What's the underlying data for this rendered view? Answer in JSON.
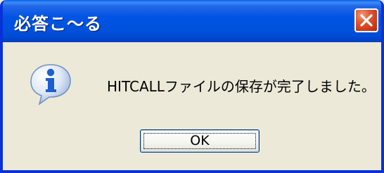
{
  "dialog": {
    "title": "必答こ〜る",
    "message": "HITCALLファイルの保存が完了しました。",
    "ok_label": "OK",
    "icon": "info-icon",
    "close_icon": "close-icon"
  },
  "colors": {
    "titlebar": "#0054e3",
    "frame": "#0831d9",
    "background": "#ece9d8",
    "close_button": "#e05a33",
    "info_icon": "#1c5fd2"
  }
}
